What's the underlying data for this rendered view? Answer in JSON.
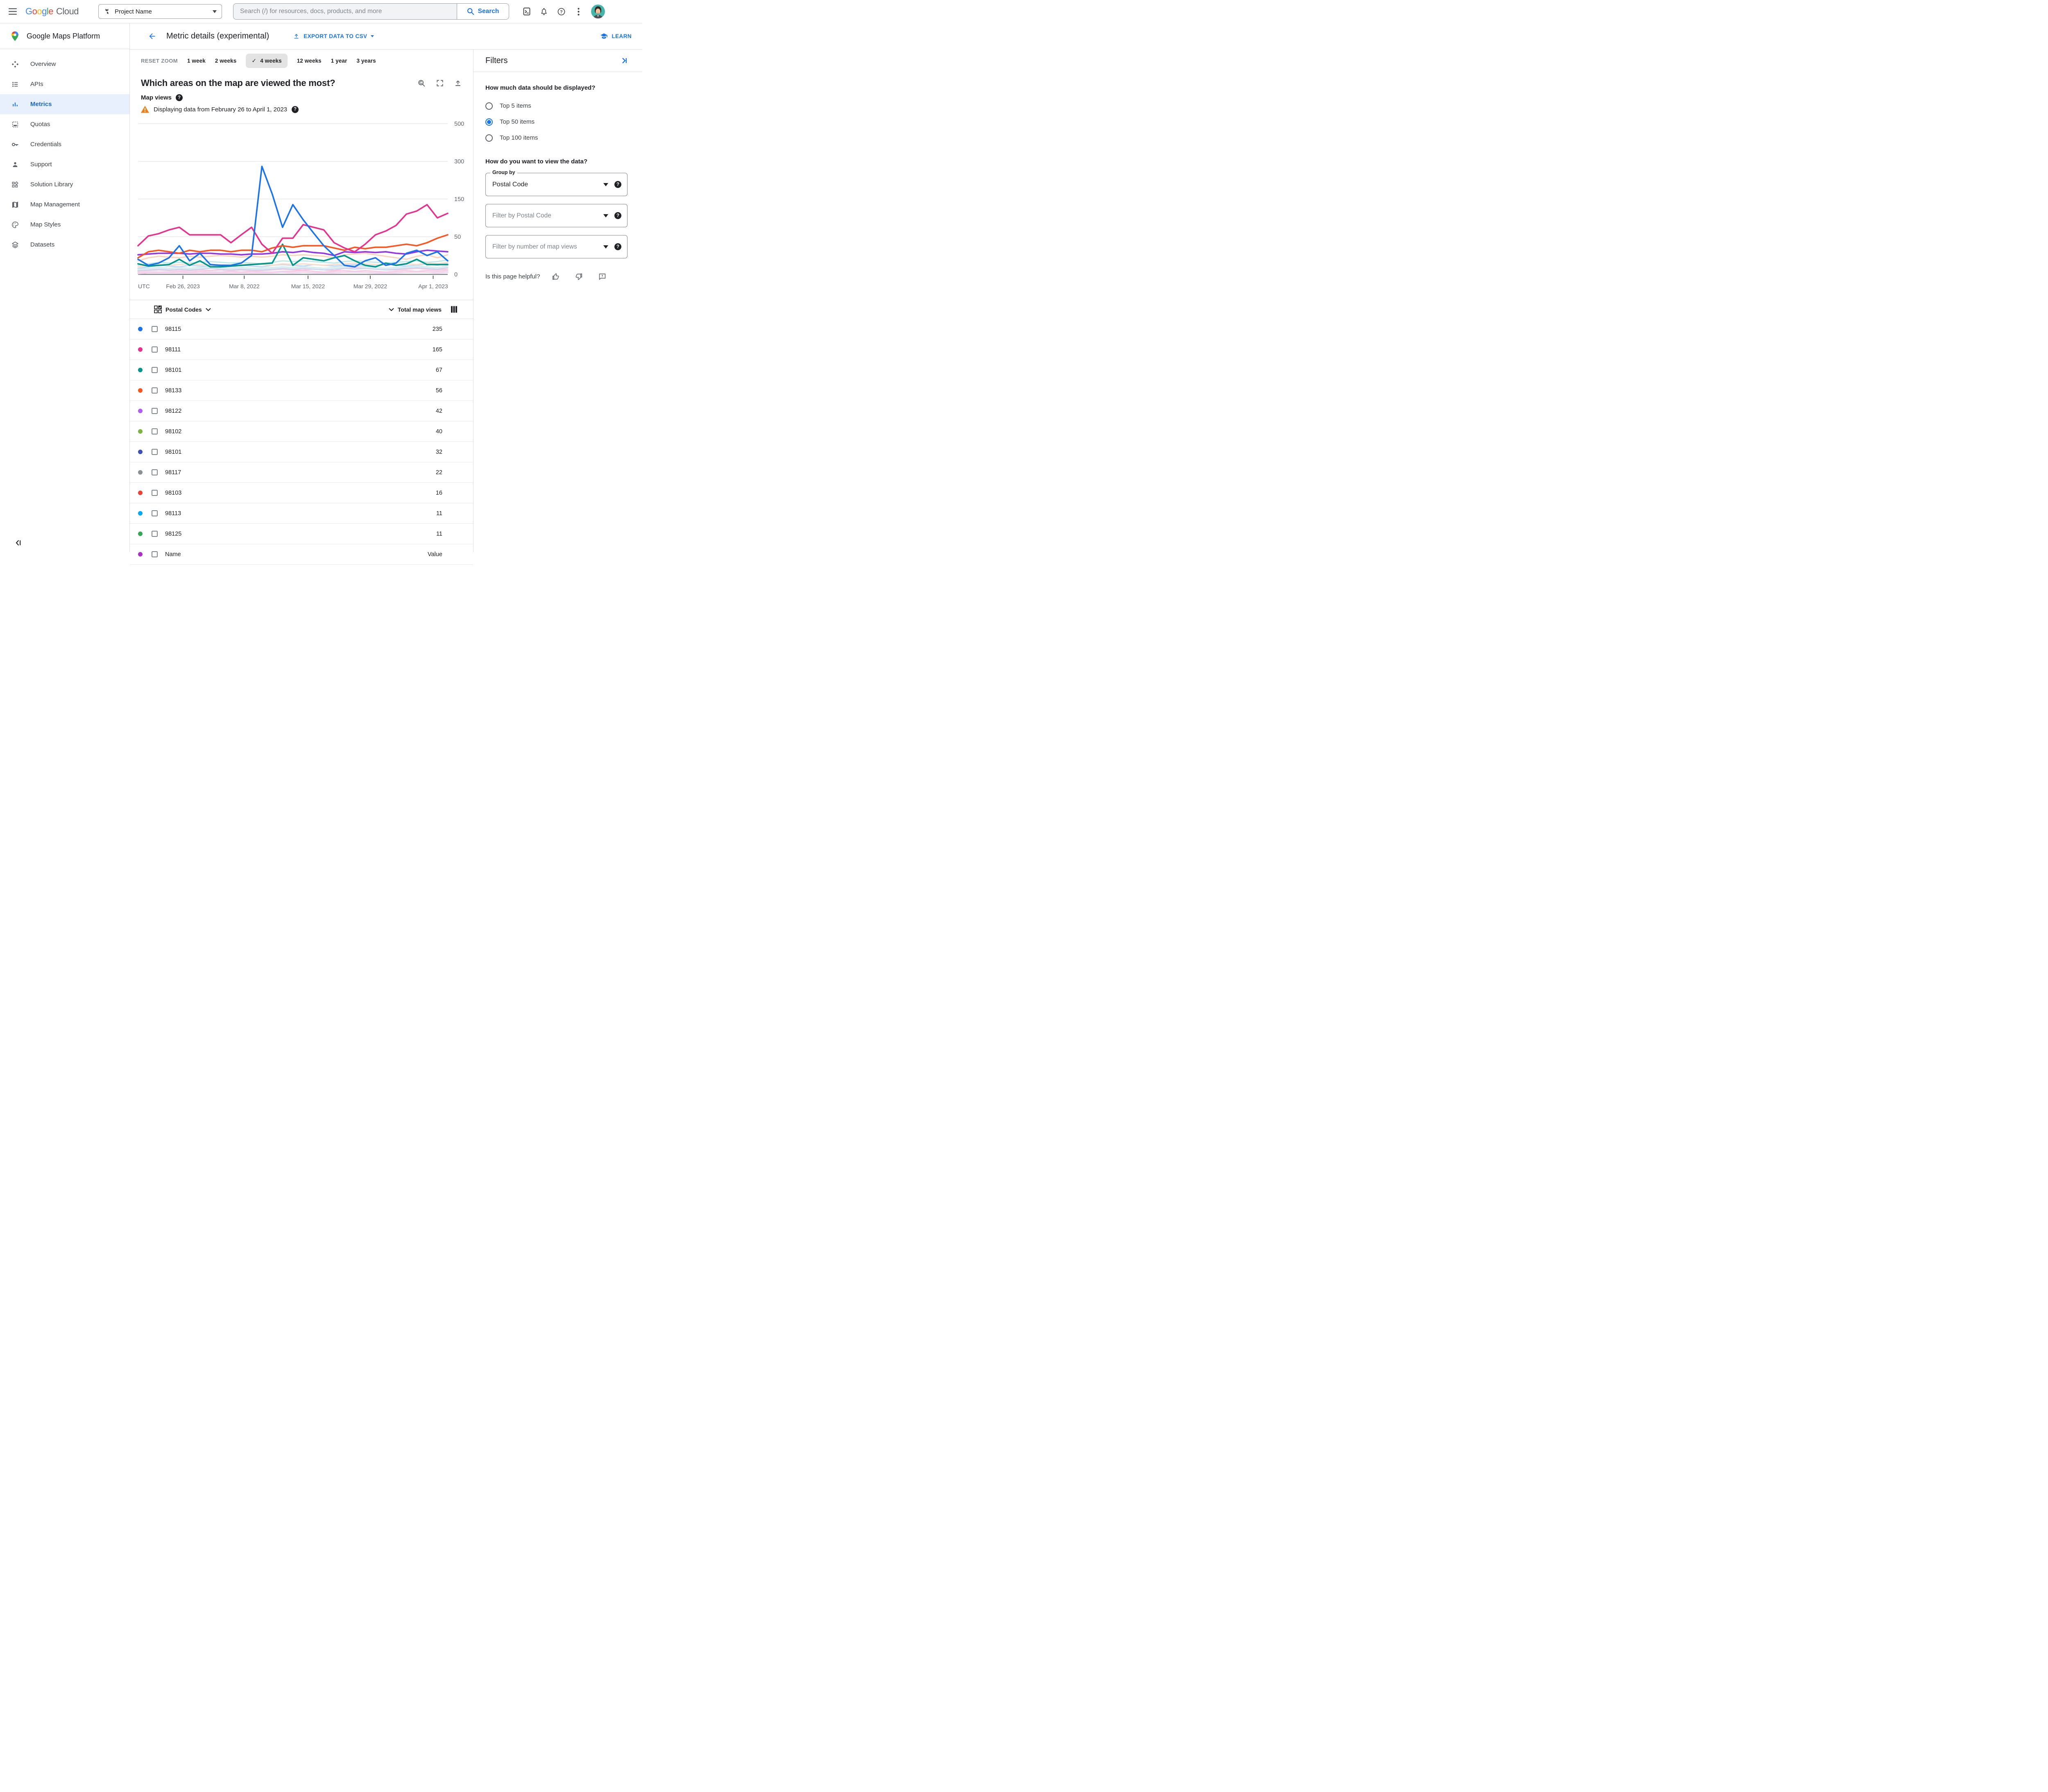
{
  "topbar": {
    "logo": {
      "letters": [
        {
          "ch": "G",
          "c": "#4285F4"
        },
        {
          "ch": "o",
          "c": "#EA4335"
        },
        {
          "ch": "o",
          "c": "#FBBC05"
        },
        {
          "ch": "g",
          "c": "#4285F4"
        },
        {
          "ch": "l",
          "c": "#34A853"
        },
        {
          "ch": "e",
          "c": "#EA4335"
        }
      ],
      "cloud": "Cloud"
    },
    "project_selector": "Project Name",
    "search_placeholder": "Search (/) for resources, docs, products, and more",
    "search_button": "Search"
  },
  "sidebar": {
    "product": "Google Maps Platform",
    "items": [
      {
        "label": "Overview",
        "icon": "overview-icon",
        "active": false
      },
      {
        "label": "APIs",
        "icon": "apis-icon",
        "active": false
      },
      {
        "label": "Metrics",
        "icon": "metrics-icon",
        "active": true
      },
      {
        "label": "Quotas",
        "icon": "quotas-icon",
        "active": false
      },
      {
        "label": "Credentials",
        "icon": "credentials-icon",
        "active": false
      },
      {
        "label": "Support",
        "icon": "support-icon",
        "active": false
      },
      {
        "label": "Solution Library",
        "icon": "solution-library-icon",
        "active": false
      },
      {
        "label": "Map Management",
        "icon": "map-management-icon",
        "active": false
      },
      {
        "label": "Map Styles",
        "icon": "map-styles-icon",
        "active": false
      },
      {
        "label": "Datasets",
        "icon": "datasets-icon",
        "active": false
      }
    ]
  },
  "header": {
    "title": "Metric details (experimental)",
    "export_button": "EXPORT DATA TO CSV",
    "learn_link": "LEARN"
  },
  "time_controls": {
    "reset_zoom": "RESET ZOOM",
    "ranges": [
      "1 week",
      "2 weeks",
      "4 weeks",
      "12 weeks",
      "1 year",
      "3 years"
    ],
    "selected": "4 weeks"
  },
  "metric_panel": {
    "question": "Which areas on the map are viewed the most?",
    "metric_label": "Map views",
    "warning": "Displaying data from February 26 to April 1, 2023",
    "utc_label": "UTC"
  },
  "chart_data": {
    "type": "line",
    "title": "Which areas on the map are viewed the most?",
    "ylabel": "Map views",
    "y_ticks": [
      0,
      50,
      150,
      300,
      500
    ],
    "y_scale_note": "tick values 0/50/150/300/500 are evenly spaced (non-linear axis)",
    "grid": true,
    "x_tick_labels": [
      "Feb 26, 2023",
      "Mar 8, 2022",
      "Mar 15, 2022",
      "Mar 29, 2022",
      "Apr 1, 2023"
    ],
    "x_tick_fractions": [
      0.145,
      0.343,
      0.549,
      0.75,
      0.953
    ],
    "series": [
      {
        "name": "98115",
        "color": "#1a73e8",
        "faded": false,
        "values": [
          20,
          12,
          15,
          22,
          38,
          18,
          28,
          13,
          12,
          12,
          15,
          25,
          280,
          170,
          75,
          135,
          95,
          60,
          38,
          25,
          12,
          10,
          18,
          22,
          12,
          15,
          28,
          32,
          25,
          30,
          18
        ]
      },
      {
        "name": "98111",
        "color": "#e8318c",
        "faded": false,
        "values": [
          38,
          52,
          58,
          68,
          75,
          55,
          55,
          55,
          55,
          42,
          55,
          75,
          40,
          28,
          48,
          48,
          82,
          75,
          68,
          42,
          35,
          30,
          40,
          55,
          65,
          80,
          110,
          118,
          135,
          100,
          112
        ]
      },
      {
        "name": "98133",
        "color": "#fa551e",
        "faded": false,
        "values": [
          22,
          30,
          32,
          30,
          28,
          32,
          30,
          32,
          32,
          30,
          32,
          32,
          30,
          35,
          38,
          36,
          38,
          38,
          38,
          35,
          32,
          36,
          34,
          36,
          36,
          38,
          40,
          38,
          42,
          48,
          55
        ]
      },
      {
        "name": "98122",
        "color": "#9334e6",
        "faded": false,
        "values": [
          26,
          27,
          28,
          28,
          28,
          27,
          28,
          28,
          27,
          27,
          26,
          27,
          27,
          28,
          30,
          29,
          31,
          29,
          28,
          25,
          30,
          29,
          30,
          29,
          30,
          28,
          27,
          30,
          32,
          31,
          30
        ]
      },
      {
        "name": "98101",
        "color": "#00968b",
        "faded": false,
        "values": [
          14,
          11,
          12,
          13,
          20,
          12,
          18,
          10,
          10,
          11,
          12,
          13,
          14,
          15,
          40,
          12,
          22,
          20,
          18,
          22,
          25,
          18,
          12,
          10,
          15,
          12,
          14,
          20,
          13,
          13,
          13
        ]
      },
      {
        "name": "other",
        "color": "#fbd3bc",
        "faded": true,
        "values": [
          18,
          22,
          24,
          23,
          22,
          24,
          23,
          24,
          25,
          24,
          23,
          24,
          23,
          24,
          26,
          25,
          26,
          25,
          24,
          22,
          26,
          27,
          28,
          26,
          24,
          22,
          20,
          24,
          26,
          22,
          26
        ]
      },
      {
        "name": "other",
        "color": "#c3d9f7",
        "faded": true,
        "values": [
          8,
          10,
          12,
          11,
          10,
          12,
          11,
          10,
          12,
          11,
          12,
          11,
          10,
          12,
          13,
          12,
          11,
          13,
          12,
          11,
          12,
          13,
          12,
          11,
          13,
          12,
          11,
          12,
          14,
          12,
          15
        ]
      },
      {
        "name": "other",
        "color": "#bfe8e8",
        "faded": true,
        "values": [
          12,
          14,
          16,
          15,
          16,
          15,
          16,
          17,
          16,
          15,
          16,
          15,
          14,
          16,
          18,
          17,
          18,
          17,
          16,
          15,
          17,
          18,
          17,
          16,
          15,
          16,
          17,
          18,
          16,
          17,
          19
        ]
      },
      {
        "name": "other",
        "color": "#f8c8dc",
        "faded": true,
        "values": [
          4,
          5,
          6,
          5,
          6,
          5,
          6,
          5,
          6,
          5,
          6,
          5,
          5,
          6,
          7,
          6,
          6,
          7,
          6,
          5,
          8,
          9,
          8,
          7,
          6,
          6,
          7,
          8,
          7,
          6,
          7
        ]
      },
      {
        "name": "other",
        "color": "#fbdcc8",
        "faded": true,
        "values": [
          10,
          12,
          13,
          12,
          13,
          14,
          13,
          12,
          13,
          12,
          13,
          14,
          13,
          12,
          14,
          13,
          14,
          13,
          12,
          13,
          14,
          15,
          14,
          13,
          12,
          13,
          14,
          13,
          15,
          14,
          16
        ]
      },
      {
        "name": "other",
        "color": "#cdd8f2",
        "faded": true,
        "values": [
          5,
          6,
          7,
          6,
          7,
          6,
          7,
          8,
          7,
          6,
          7,
          6,
          6,
          7,
          8,
          7,
          8,
          7,
          6,
          7,
          8,
          7,
          8,
          7,
          6,
          7,
          8,
          9,
          8,
          7,
          9
        ]
      },
      {
        "name": "other",
        "color": "#f6cce4",
        "faded": true,
        "values": [
          2,
          3,
          3,
          3,
          4,
          3,
          4,
          3,
          3,
          4,
          3,
          4,
          3,
          3,
          4,
          4,
          5,
          4,
          3,
          4,
          5,
          4,
          5,
          4,
          3,
          4,
          5,
          4,
          5,
          4,
          5
        ]
      },
      {
        "name": "other",
        "color": "#d2ecec",
        "faded": true,
        "values": [
          7,
          8,
          9,
          8,
          9,
          8,
          9,
          10,
          9,
          8,
          9,
          8,
          8,
          9,
          10,
          9,
          10,
          9,
          8,
          9,
          10,
          11,
          10,
          9,
          8,
          9,
          10,
          11,
          10,
          9,
          11
        ]
      },
      {
        "name": "other",
        "color": "#f3d3ef",
        "faded": true,
        "values": [
          1,
          2,
          2,
          2,
          2,
          2,
          2,
          2,
          2,
          2,
          2,
          2,
          2,
          2,
          3,
          2,
          3,
          2,
          2,
          2,
          3,
          3,
          3,
          2,
          2,
          2,
          3,
          3,
          3,
          2,
          3
        ]
      }
    ]
  },
  "table": {
    "group_header": "Postal Codes",
    "value_header": "Total map views",
    "rows": [
      {
        "code": "98115",
        "value": "235",
        "color": "#1a73e8"
      },
      {
        "code": "98111",
        "value": "165",
        "color": "#e8318c"
      },
      {
        "code": "98101",
        "value": "67",
        "color": "#00968b"
      },
      {
        "code": "98133",
        "value": "56",
        "color": "#fa551e"
      },
      {
        "code": "98122",
        "value": "42",
        "color": "#b15cf4"
      },
      {
        "code": "98102",
        "value": "40",
        "color": "#7cb342"
      },
      {
        "code": "98101",
        "value": "32",
        "color": "#3f51b5"
      },
      {
        "code": "98117",
        "value": "22",
        "color": "#8b9095"
      },
      {
        "code": "98103",
        "value": "16",
        "color": "#ea4335"
      },
      {
        "code": "98113",
        "value": "11",
        "color": "#03a9f4"
      },
      {
        "code": "98125",
        "value": "11",
        "color": "#34a853"
      },
      {
        "code": "Name",
        "value": "Value",
        "color": "#ab30c4",
        "partial": true
      }
    ]
  },
  "filters": {
    "title": "Filters",
    "question_display": "How much data should be displayed?",
    "display_options": [
      {
        "label": "Top 5 items",
        "selected": false
      },
      {
        "label": "Top 50 items",
        "selected": true
      },
      {
        "label": "Top 100 items",
        "selected": false
      }
    ],
    "question_view": "How do you want to view the data?",
    "group_by_label": "Group by",
    "group_by_value": "Postal Code",
    "postal_filter_placeholder": "Filter by Postal Code",
    "views_filter_placeholder": "Filter by number of map views",
    "helpful_prompt": "Is this page helpful?"
  }
}
